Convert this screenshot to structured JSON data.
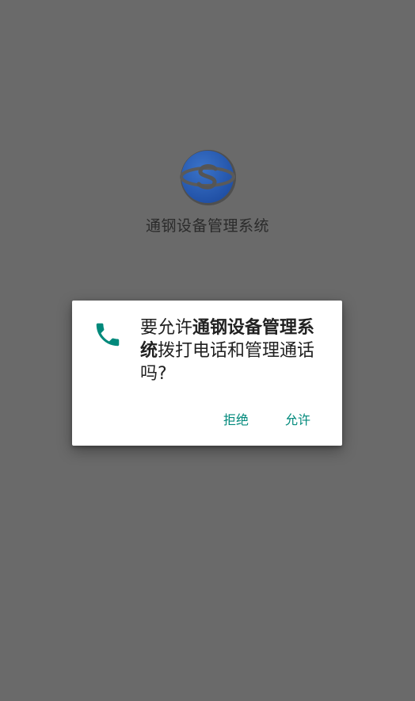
{
  "app": {
    "name": "通钢设备管理系统",
    "icon": "company-logo"
  },
  "dialog": {
    "icon": "phone-icon",
    "accent_color": "#00897b",
    "message_prefix": "要允许",
    "message_app": "通钢设备管理系统",
    "message_suffix": "拨打电话和管理通话吗?",
    "deny_label": "拒绝",
    "allow_label": "允许"
  }
}
